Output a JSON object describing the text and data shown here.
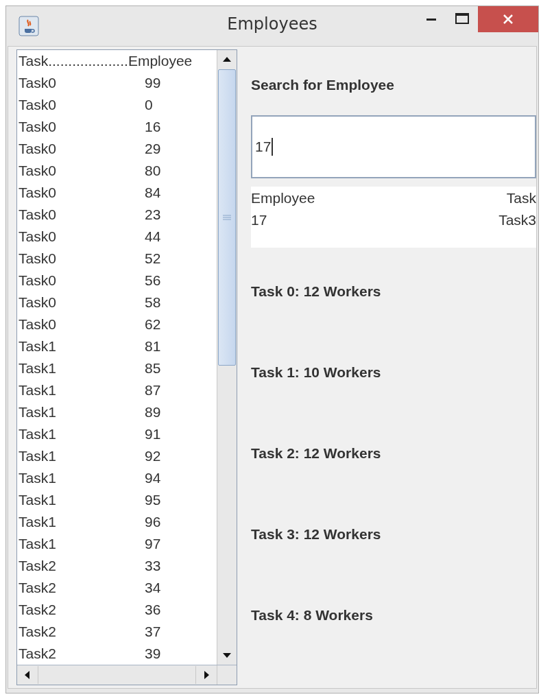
{
  "window": {
    "title": "Employees"
  },
  "list": {
    "header": {
      "task": "Task....................",
      "employee": "Employee"
    },
    "rows": [
      {
        "task": "Task0",
        "employee": "99"
      },
      {
        "task": "Task0",
        "employee": "0"
      },
      {
        "task": "Task0",
        "employee": "16"
      },
      {
        "task": "Task0",
        "employee": "29"
      },
      {
        "task": "Task0",
        "employee": "80"
      },
      {
        "task": "Task0",
        "employee": "84"
      },
      {
        "task": "Task0",
        "employee": "23"
      },
      {
        "task": "Task0",
        "employee": "44"
      },
      {
        "task": "Task0",
        "employee": "52"
      },
      {
        "task": "Task0",
        "employee": "56"
      },
      {
        "task": "Task0",
        "employee": "58"
      },
      {
        "task": "Task0",
        "employee": "62"
      },
      {
        "task": "Task1",
        "employee": "81"
      },
      {
        "task": "Task1",
        "employee": "85"
      },
      {
        "task": "Task1",
        "employee": "87"
      },
      {
        "task": "Task1",
        "employee": "89"
      },
      {
        "task": "Task1",
        "employee": "91"
      },
      {
        "task": "Task1",
        "employee": "92"
      },
      {
        "task": "Task1",
        "employee": "94"
      },
      {
        "task": "Task1",
        "employee": "95"
      },
      {
        "task": "Task1",
        "employee": "96"
      },
      {
        "task": "Task1",
        "employee": "97"
      },
      {
        "task": "Task2",
        "employee": "33"
      },
      {
        "task": "Task2",
        "employee": "34"
      },
      {
        "task": "Task2",
        "employee": "36"
      },
      {
        "task": "Task2",
        "employee": "37"
      },
      {
        "task": "Task2",
        "employee": "39"
      }
    ]
  },
  "search": {
    "label": "Search for Employee",
    "value": "17"
  },
  "result": {
    "columns": [
      "Employee",
      "Task"
    ],
    "rows": [
      [
        "17",
        "Task3"
      ]
    ]
  },
  "summaries": [
    "Task 0: 12 Workers",
    "Task 1: 10 Workers",
    "Task 2: 12 Workers",
    "Task 3: 12 Workers",
    "Task 4: 8 Workers"
  ]
}
